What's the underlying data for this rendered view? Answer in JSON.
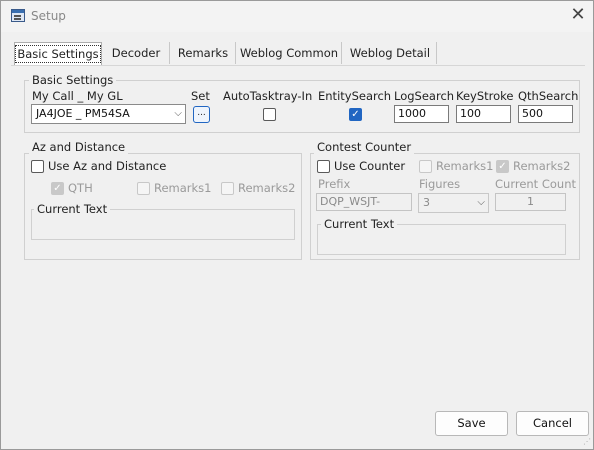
{
  "window": {
    "title": "Setup",
    "close_symbol": "✕"
  },
  "tabs": [
    "Basic Settings",
    "Decoder",
    "Remarks",
    "Weblog Common",
    "Weblog Detail"
  ],
  "basic": {
    "group_label": "Basic Settings",
    "mycall_label": "My Call _ My GL",
    "mycall_value": "JA4JOE _ PM54SA",
    "set_label": "Set",
    "set_button": "...",
    "autotasktray_label": "AutoTasktray-In",
    "autotasktray_checked": false,
    "entitysearch_label": "EntitySearch",
    "entitysearch_checked": true,
    "logsearch_label": "LogSearch",
    "logsearch_value": "1000",
    "keystroke_label": "KeyStroke",
    "keystroke_value": "100",
    "qthsearch_label": "QthSearch",
    "qthsearch_value": "500"
  },
  "az": {
    "group_label": "Az and Distance",
    "use_label": "Use Az and Distance",
    "use_checked": false,
    "qth_label": "QTH",
    "qth_checked": true,
    "remarks1_label": "Remarks1",
    "remarks2_label": "Remarks2",
    "current_text_label": "Current Text"
  },
  "contest": {
    "group_label": "Contest Counter",
    "use_label": "Use Counter",
    "use_checked": false,
    "remarks1_label": "Remarks1",
    "remarks2_label": "Remarks2",
    "remarks2_checked": true,
    "prefix_label": "Prefix",
    "prefix_value": "DQP_WSJT-",
    "figures_label": "Figures",
    "figures_value": "3",
    "current_count_label": "Current Count",
    "current_count_value": "1",
    "current_text_label": "Current Text"
  },
  "footer": {
    "save_label": "Save",
    "cancel_label": "Cancel"
  },
  "colors": {
    "accent": "#2166c2",
    "background": "#f0f0f0"
  }
}
